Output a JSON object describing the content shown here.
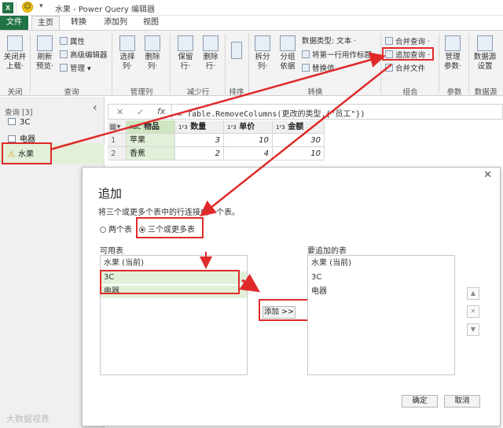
{
  "titlebar": {
    "app_icon": "X",
    "title": "水果 - Power Query 编辑器",
    "dropdown": "▾"
  },
  "tabs": [
    "文件",
    "主页",
    "转换",
    "添加列",
    "视图"
  ],
  "ribbon": {
    "close_load": "关闭并\n上载·",
    "refresh": "刷新\n预览·",
    "properties": "属性",
    "advanced_editor": "高级编辑器",
    "manage": "管理 ▾",
    "choose_cols": "选择\n列·",
    "remove_cols": "删除\n列·",
    "keep_rows": "保留\n行·",
    "remove_rows": "删除\n行·",
    "sort": "",
    "split_col": "拆分\n列·",
    "group_by": "分组\n依据",
    "data_type": "数据类型: 文本 ·",
    "first_row_header": "将第一行用作标题 ·",
    "replace_values": "替换值",
    "merge_queries": "合并查询 ·",
    "append_queries": "追加查询 ·",
    "combine_files": "合并文件",
    "manage_params": "管理\n参数·",
    "data_source": "数据源\n设置",
    "groups": {
      "close": "关闭",
      "query": "查询",
      "manage_cols": "管理列",
      "reduce_rows": "减少行",
      "sort": "排序",
      "transform": "转换",
      "combine": "组合",
      "params": "参数",
      "data_source": "数据源"
    }
  },
  "leftpane": {
    "header": "查询 [3]",
    "collapse": "‹",
    "items": [
      "3C",
      "电器",
      "水果"
    ]
  },
  "formula": {
    "cancel": "✕",
    "confirm": "✓",
    "fx": "fx",
    "text": "= Table.RemoveColumns(更改的类型,{\"员工\"})"
  },
  "grid": {
    "headers": [
      "物品",
      "数量",
      "单价",
      "金额"
    ],
    "header_types": [
      "ABC",
      "1²3",
      "1²3",
      "1²3"
    ],
    "rows": [
      {
        "n": "1",
        "item": "苹果",
        "qty": "3",
        "price": "10",
        "amount": "30"
      },
      {
        "n": "2",
        "item": "香蕉",
        "qty": "2",
        "price": "4",
        "amount": "10"
      }
    ]
  },
  "dialog": {
    "close": "✕",
    "title": "追加",
    "desc": "将三个或更多个表中的行连接成一个表。",
    "radio_two": "两个表",
    "radio_three": "三个或更多表",
    "available_label": "可用表",
    "available": [
      "水果 (当前)",
      "3C",
      "电器"
    ],
    "append_label": "要追加的表",
    "appended": [
      "水果 (当前)",
      "3C",
      "电器"
    ],
    "add_button": "添加 >>",
    "up": "▲",
    "remove": "✕",
    "down": "▼",
    "ok": "确定",
    "cancel": "取消"
  },
  "watermark": "大数据视界",
  "colors": {
    "accent": "#217346",
    "annotation": "#e02a2a",
    "selected_row": "#e2f0d9"
  }
}
